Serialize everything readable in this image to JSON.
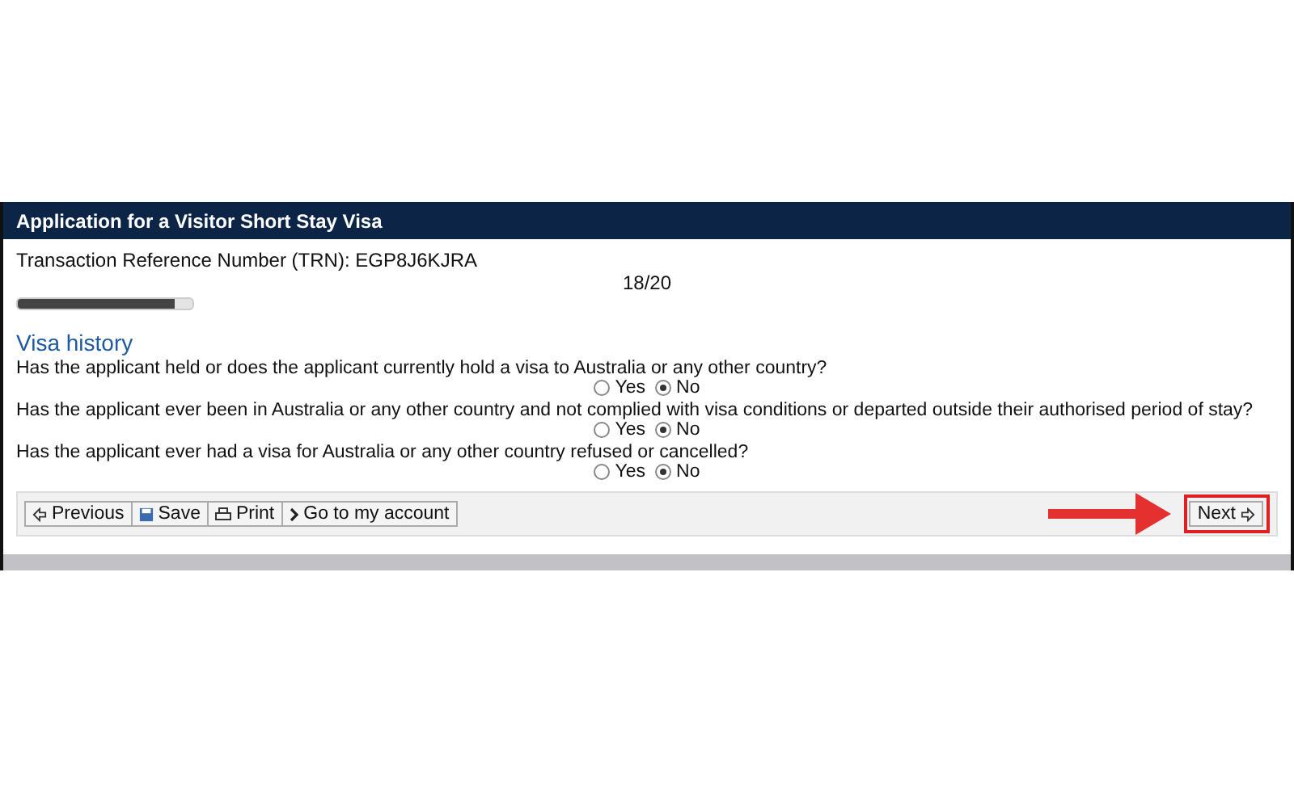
{
  "header": {
    "title": "Application for a Visitor Short Stay Visa"
  },
  "trn": "Transaction Reference Number (TRN): EGP8J6KJRA",
  "progress": {
    "reading": "18/20",
    "level": 0.9
  },
  "section": {
    "title": "Visa history"
  },
  "questions": [
    {
      "text": "Has the applicant held or does the applicant currently hold a visa to Australia or any other country?",
      "options": [
        {
          "label": "Yes",
          "selected": false
        },
        {
          "label": "No",
          "selected": true
        }
      ]
    },
    {
      "text": "Has the applicant ever been in Australia or any other country and not complied with visa conditions or departed outside their authorised period of stay?",
      "options": [
        {
          "label": "Yes",
          "selected": false
        },
        {
          "label": "No",
          "selected": true
        }
      ]
    },
    {
      "text": "Has the applicant ever had a visa for Australia or any other country refused or cancelled?",
      "options": [
        {
          "label": "Yes",
          "selected": false
        },
        {
          "label": "No",
          "selected": true
        }
      ]
    }
  ],
  "toolbar": [
    {
      "kind": "previous",
      "label": "Previous"
    },
    {
      "kind": "save",
      "label": "Save"
    },
    {
      "kind": "print",
      "label": "Print"
    },
    {
      "kind": "account",
      "label": "Go to my account"
    }
  ],
  "next": {
    "label": "Next",
    "highlighted": true
  }
}
